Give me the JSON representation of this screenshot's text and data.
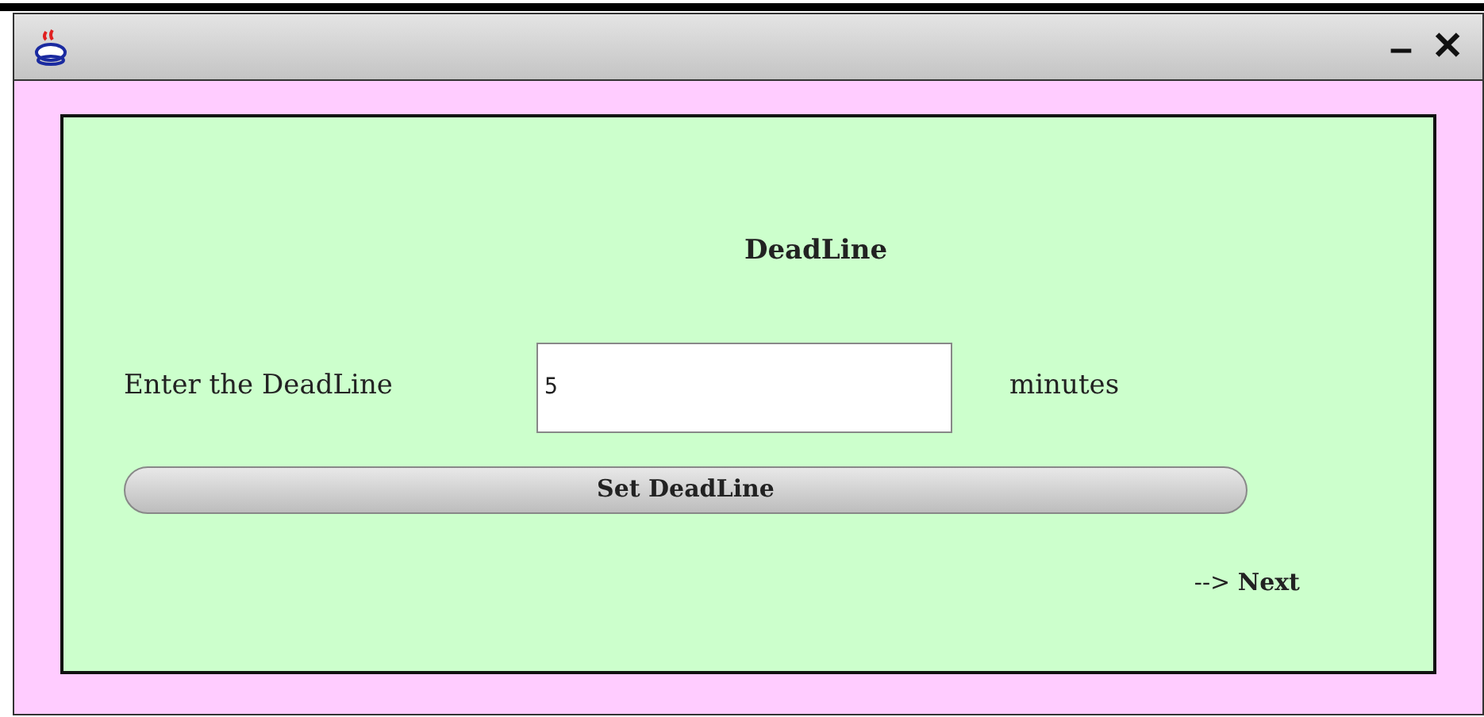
{
  "window": {
    "title_bar_buttons": [
      "–",
      "✕"
    ]
  },
  "panel": {
    "heading": "DeadLine",
    "field_label": "Enter the DeadLine",
    "field_value": "5",
    "unit": "minutes",
    "button": "Set DeadLine",
    "next_link": "--> **Next**"
  }
}
